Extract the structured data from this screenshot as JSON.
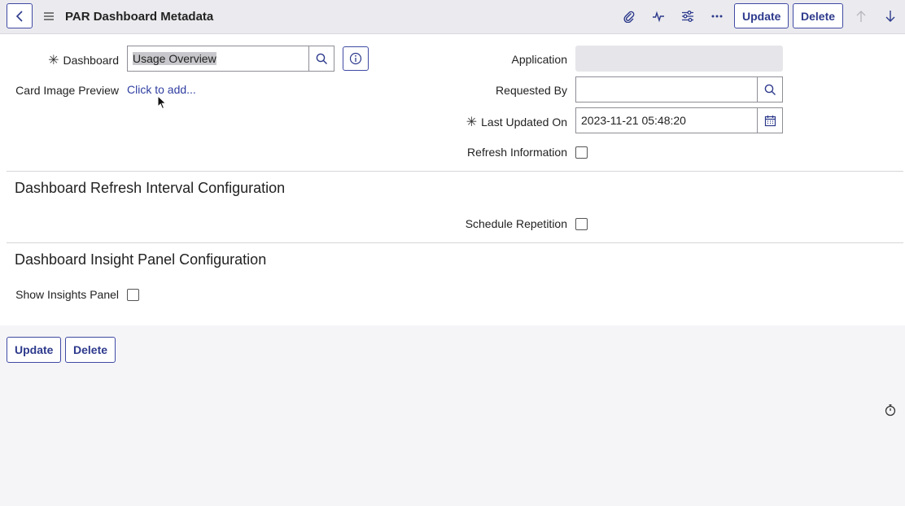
{
  "header": {
    "title": "PAR Dashboard Metadata",
    "icons": [
      "paperclip-icon",
      "activity-icon",
      "sliders-icon",
      "more-icon",
      "arrow-up-icon",
      "arrow-down-icon"
    ],
    "update_label": "Update",
    "delete_label": "Delete"
  },
  "form": {
    "dashboard": {
      "label": "Dashboard",
      "value": "Usage Overview"
    },
    "card_image_preview": {
      "label": "Card Image Preview",
      "link": "Click to add..."
    },
    "application": {
      "label": "Application",
      "value": ""
    },
    "requested_by": {
      "label": "Requested By",
      "value": ""
    },
    "last_updated_on": {
      "label": "Last Updated On",
      "value": "2023-11-21 05:48:20"
    },
    "refresh_information": {
      "label": "Refresh Information",
      "checked": false
    }
  },
  "sections": {
    "refresh": {
      "title": "Dashboard Refresh Interval Configuration",
      "schedule_repetition": {
        "label": "Schedule Repetition",
        "checked": false
      }
    },
    "insight": {
      "title": "Dashboard Insight Panel Configuration",
      "show_insights_panel": {
        "label": "Show Insights Panel",
        "checked": false
      }
    }
  },
  "footer": {
    "update_label": "Update",
    "delete_label": "Delete"
  },
  "colors": {
    "accent": "#3f4aa3",
    "link": "#2f3ea0",
    "header_bg": "#ebebef",
    "page_bg": "#f5f5f8"
  }
}
